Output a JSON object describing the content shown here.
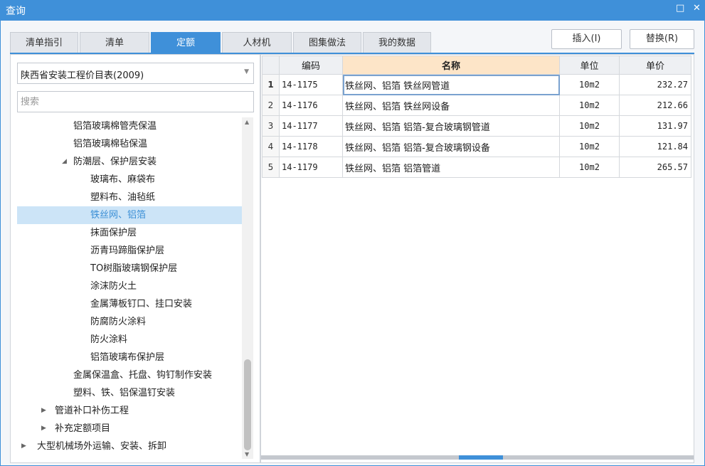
{
  "window": {
    "title": "查询",
    "maximize_glyph": "□",
    "close_glyph": "✕"
  },
  "tabs": [
    {
      "label": "清单指引"
    },
    {
      "label": "清单"
    },
    {
      "label": "定额",
      "active": true
    },
    {
      "label": "人材机"
    },
    {
      "label": "图集做法"
    },
    {
      "label": "我的数据"
    }
  ],
  "toolbar": {
    "insert_label": "插入(I)",
    "replace_label": "替换(R)"
  },
  "left": {
    "library_value": "陕西省安装工程价目表(2009)",
    "search_placeholder": "搜索",
    "tree": [
      {
        "label": "铝箔玻璃棉管壳保温"
      },
      {
        "label": "铝箔玻璃棉毡保温"
      },
      {
        "label": "防潮层、保护层安装",
        "expander": "◢"
      },
      {
        "label": "玻璃布、麻袋布"
      },
      {
        "label": "塑料布、油毡纸"
      },
      {
        "label": "铁丝网、铝箔",
        "selected": true
      },
      {
        "label": "抹面保护层"
      },
      {
        "label": "沥青玛蹄脂保护层"
      },
      {
        "label": "TO树脂玻璃钢保护层"
      },
      {
        "label": "涂沫防火土"
      },
      {
        "label": "金属薄板钉口、挂口安装"
      },
      {
        "label": "防腐防火涂料"
      },
      {
        "label": "防火涂料"
      },
      {
        "label": "铝箔玻璃布保护层"
      },
      {
        "label": "金属保温盒、托盘、钩钉制作安装"
      },
      {
        "label": "塑料、铁、铝保温钉安装"
      },
      {
        "label": "管道补口补伤工程",
        "expander": "▶"
      },
      {
        "label": "补充定额项目",
        "expander": "▶"
      },
      {
        "label": "大型机械场外运输、安装、拆卸",
        "expander": "▶"
      }
    ]
  },
  "grid": {
    "headers": {
      "code": "编码",
      "name": "名称",
      "unit": "单位",
      "price": "单价"
    },
    "rows": [
      {
        "num": "1",
        "code": "14-1175",
        "name": "铁丝网、铝箔 铁丝网管道",
        "unit": "10m2",
        "price": "232.27"
      },
      {
        "num": "2",
        "code": "14-1176",
        "name": "铁丝网、铝箔 铁丝网设备",
        "unit": "10m2",
        "price": "212.66"
      },
      {
        "num": "3",
        "code": "14-1177",
        "name": "铁丝网、铝箔 铝箔-复合玻璃钢管道",
        "unit": "10m2",
        "price": "131.97"
      },
      {
        "num": "4",
        "code": "14-1178",
        "name": "铁丝网、铝箔 铝箔-复合玻璃钢设备",
        "unit": "10m2",
        "price": "121.84"
      },
      {
        "num": "5",
        "code": "14-1179",
        "name": "铁丝网、铝箔 铝箔管道",
        "unit": "10m2",
        "price": "265.57"
      }
    ]
  },
  "colors": {
    "accent": "#3f90d9",
    "selection": "#cce4f7",
    "active_header": "#fde5c8"
  }
}
